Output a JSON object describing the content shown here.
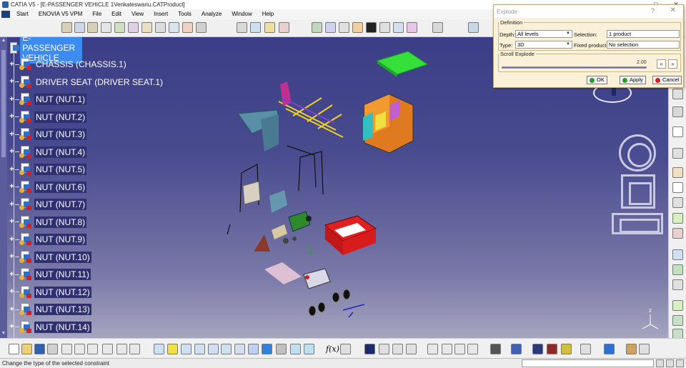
{
  "window": {
    "title": "CATIA V5 - [E-PASSENGER VEHICLE 1Venkateswariu.CATProduct]",
    "controls": [
      "—",
      "□",
      "✕"
    ]
  },
  "menubar": {
    "items": [
      "Start",
      "ENOVIA V5 VPM",
      "File",
      "Edit",
      "View",
      "Insert",
      "Tools",
      "Analyze",
      "Window",
      "Help"
    ],
    "mdi_controls": [
      "_",
      "▫",
      "x"
    ]
  },
  "tree": {
    "root": "E- PASSENGER VEHICLE",
    "nodes": [
      "CHASSIS (CHASSIS.1)",
      "DRIVER SEAT (DRIVER SEAT.1)",
      "NUT (NUT.1)",
      "NUT (NUT.2)",
      "NUT (NUT.3)",
      "NUT (NUT.4)",
      "NUT (NUT.5)",
      "NUT (NUT.6)",
      "NUT (NUT.7)",
      "NUT (NUT.8)",
      "NUT (NUT.9)",
      "NUT (NUT.10)",
      "NUT (NUT.11)",
      "NUT (NUT.12)",
      "NUT (NUT.13)",
      "NUT (NUT.14)"
    ]
  },
  "axis": {
    "z_label": "z"
  },
  "toolbar": {
    "fx_label": "f(x)"
  },
  "dialog": {
    "title": "Explode",
    "help": "?",
    "close": "✕",
    "definition_legend": "Definition",
    "depth_label": "Depth:",
    "depth_value": "All levels",
    "selection_label": "Selection:",
    "selection_value": "1 product",
    "type_label": "Type:",
    "type_value": "3D",
    "fixed_label": "Fixed product:",
    "fixed_value": "No selection",
    "scroll_legend": "Scroll Explode",
    "scroll_value": "2.00",
    "scroll_fraction": 1.0,
    "nav_first": "K",
    "nav_last": "K",
    "ok_label": "OK",
    "apply_label": "Apply",
    "cancel_label": "Cancel"
  },
  "statusbar": {
    "text": "Change the type of the selected constraint"
  },
  "colors": {
    "viewport_top": "#3b3d86",
    "viewport_bottom": "#a6a5bf",
    "tree_selection": "#3c8cf0",
    "dialog_bg": "#fbf1d8"
  }
}
